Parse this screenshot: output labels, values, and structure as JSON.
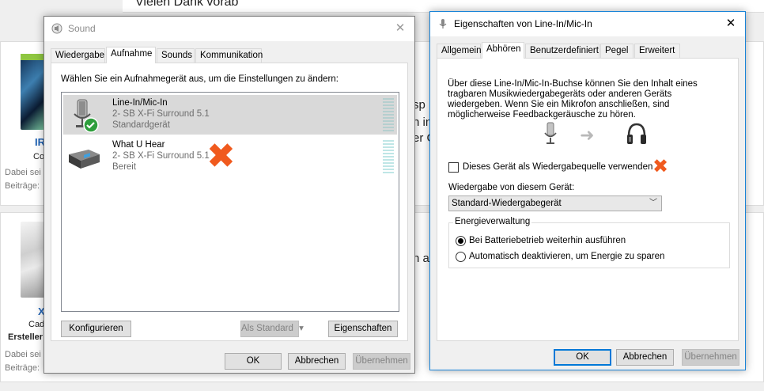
{
  "background": {
    "topbar_text": "Vielen Dank vorab",
    "user1": {
      "name": "IR",
      "sub": "Co",
      "dabei": "Dabei sei",
      "beitraege": "Beiträge:"
    },
    "user2": {
      "name": "X",
      "sub": "Cad",
      "role": "Ersteller",
      "dabei": "Dabei sei",
      "beitraege": "Beiträge:"
    },
    "fragments": [
      "sp",
      "n in",
      "er G",
      "n al"
    ]
  },
  "sound_dialog": {
    "title": "Sound",
    "close_glyph": "✕",
    "tabs": [
      "Wiedergabe",
      "Aufnahme",
      "Sounds",
      "Kommunikation"
    ],
    "selected_tab": "Aufnahme",
    "instruction": "Wählen Sie ein Aufnahmegerät aus, um die Einstellungen zu ändern:",
    "devices": [
      {
        "name": "Line-In/Mic-In",
        "driver": "2- SB X-Fi Surround 5.1",
        "status": "Standardgerät",
        "selected": true
      },
      {
        "name": "What U Hear",
        "driver": "2- SB X-Fi Surround 5.1",
        "status": "Bereit",
        "selected": false
      }
    ],
    "buttons": {
      "configure": "Konfigurieren",
      "set_default": "Als Standard",
      "set_default_arrow": "▾",
      "properties": "Eigenschaften",
      "ok": "OK",
      "cancel": "Abbrechen",
      "apply": "Übernehmen"
    },
    "annotation_mark": "✖"
  },
  "props_dialog": {
    "title": "Eigenschaften von Line-In/Mic-In",
    "close_glyph": "✕",
    "tabs": [
      "Allgemein",
      "Abhören",
      "Benutzerdefiniert",
      "Pegel",
      "Erweitert"
    ],
    "selected_tab": "Abhören",
    "description_lines": [
      "Über diese Line-In/Mic-In-Buchse können Sie den Inhalt eines",
      "tragbaren Musikwiedergabegeräts oder anderen Geräts",
      "wiedergeben. Wenn Sie ein Mikrofon anschließen, sind",
      "möglicherweise Feedbackgeräusche zu hören."
    ],
    "arrow_glyph": "➜",
    "listen_checkbox_label": "Dieses Gerät als Wiedergabequelle verwenden",
    "listen_checked": false,
    "playback_label": "Wiedergabe von diesem Gerät:",
    "playback_value": "Standard-Wiedergabegerät",
    "dropdown_arrow": "﹀",
    "power_group_label": "Energieverwaltung",
    "power_options": [
      {
        "label": "Bei Batteriebetrieb weiterhin ausführen",
        "selected": true
      },
      {
        "label": "Automatisch deaktivieren, um Energie zu sparen",
        "selected": false
      }
    ],
    "buttons": {
      "ok": "OK",
      "cancel": "Abbrechen",
      "apply": "Übernehmen"
    },
    "annotation_mark": "✖"
  },
  "colors": {
    "accent": "#0078d7",
    "annotation": "#f05a1e",
    "selection": "#d9d9d9",
    "check_green": "#2e9e3c"
  }
}
